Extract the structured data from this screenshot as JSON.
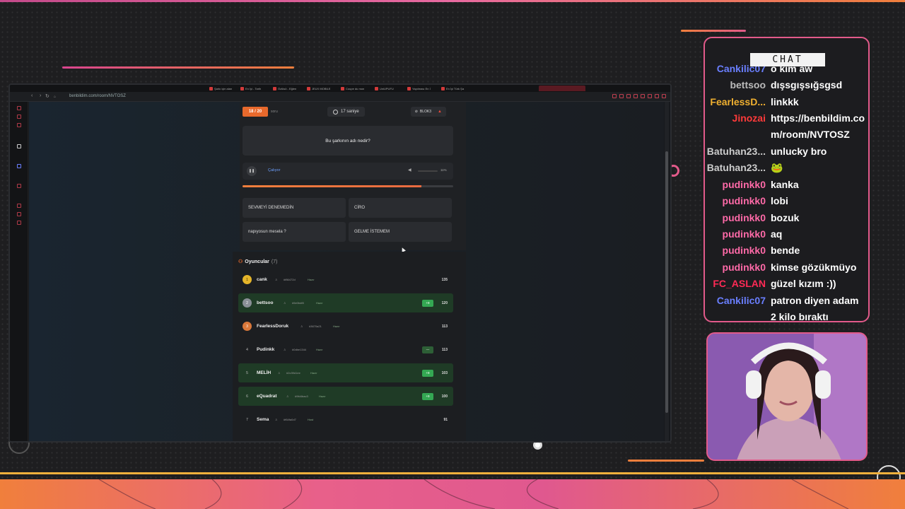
{
  "browser": {
    "url": "benbildim.com/room/NVTOSZ",
    "tabs": [
      "Şarkı için alan",
      "En İyi - Tarih",
      "Özlüsö - Eğlen",
      "JEUX MOBILE",
      "Coupe du mon",
      "UniUPUFU",
      "Yapılması En İ",
      "En İyi Türk Şa"
    ]
  },
  "quiz": {
    "counter": "18 / 20",
    "counter_sub": "soru",
    "timer": "17 saniye",
    "block": "BLOK3",
    "question": "Bu şarkının adı nedir?",
    "player_status": "Çalıyor",
    "volume": "11%",
    "progress_fraction": 0.85,
    "answers": [
      "SEVMEYİ DENEMEDİN",
      "CİRO",
      "napıyosun mesela ?",
      "GELME İSTEMEM"
    ]
  },
  "players": {
    "title": "Oyuncular",
    "count": "(7)",
    "rows": [
      {
        "rank": "1",
        "name": "cank",
        "code": "#f86472d",
        "status": "Hazır",
        "delta": "",
        "score": "135",
        "medal": "gold",
        "highlight": false
      },
      {
        "rank": "2",
        "name": "bettsoo",
        "code": "#5e0bdf8",
        "status": "Hazır",
        "delta": "+9",
        "score": "120",
        "medal": "silver",
        "highlight": true
      },
      {
        "rank": "3",
        "name": "FearlessDoruk",
        "code": "#3670a21",
        "status": "Hazır",
        "delta": "",
        "score": "113",
        "medal": "bronze",
        "highlight": false
      },
      {
        "rank": "4",
        "name": "Pudinkk",
        "code": "#0dbe1344",
        "status": "Hazır",
        "delta": "—",
        "score": "113",
        "medal": "plain",
        "highlight": false
      },
      {
        "rank": "5",
        "name": "MELİH",
        "code": "#2c39d1ee",
        "status": "Hazır",
        "delta": "+9",
        "score": "103",
        "medal": "plain",
        "highlight": true
      },
      {
        "rank": "6",
        "name": "eQuadrat",
        "code": "#9fd4bac3",
        "status": "Hazır",
        "delta": "+9",
        "score": "100",
        "medal": "plain",
        "highlight": true
      },
      {
        "rank": "7",
        "name": "Sema",
        "code": "#f64fa0d7",
        "status": "Host",
        "delta": "",
        "score": "91",
        "medal": "plain",
        "highlight": false
      }
    ]
  },
  "chat": {
    "title": "CHAT",
    "messages": [
      {
        "user": "Cankilic07",
        "text": "o kim aw",
        "color": "#6a7fff"
      },
      {
        "user": "bettsoo",
        "text": "dışsgışsığsgsd",
        "color": "#bbbbbb"
      },
      {
        "user": "FearlessD...",
        "text": "linkkk",
        "color": "#f0b030"
      },
      {
        "user": "Jinozai",
        "text": "https://benbildim.com/room/NVTOSZ",
        "color": "#ff3a3a"
      },
      {
        "user": "Batuhan23...",
        "text": "unlucky bro",
        "color": "#cccccc"
      },
      {
        "user": "Batuhan23...",
        "text": "🐸",
        "color": "#cccccc"
      },
      {
        "user": "pudinkk0",
        "text": "kanka",
        "color": "#ff6aa8"
      },
      {
        "user": "pudinkk0",
        "text": "lobi",
        "color": "#ff6aa8"
      },
      {
        "user": "pudinkk0",
        "text": "bozuk",
        "color": "#ff6aa8"
      },
      {
        "user": "pudinkk0",
        "text": "aq",
        "color": "#ff6aa8"
      },
      {
        "user": "pudinkk0",
        "text": "bende",
        "color": "#ff6aa8"
      },
      {
        "user": "pudinkk0",
        "text": "kimse gözükmüyo",
        "color": "#ff6aa8"
      },
      {
        "user": "FC_ASLAN",
        "text": "güzel kızım :))",
        "color": "#ff2a55"
      },
      {
        "user": "Cankilic07",
        "text": "patron diyen adam 2 kilo bıraktı",
        "color": "#6a7fff"
      }
    ]
  }
}
